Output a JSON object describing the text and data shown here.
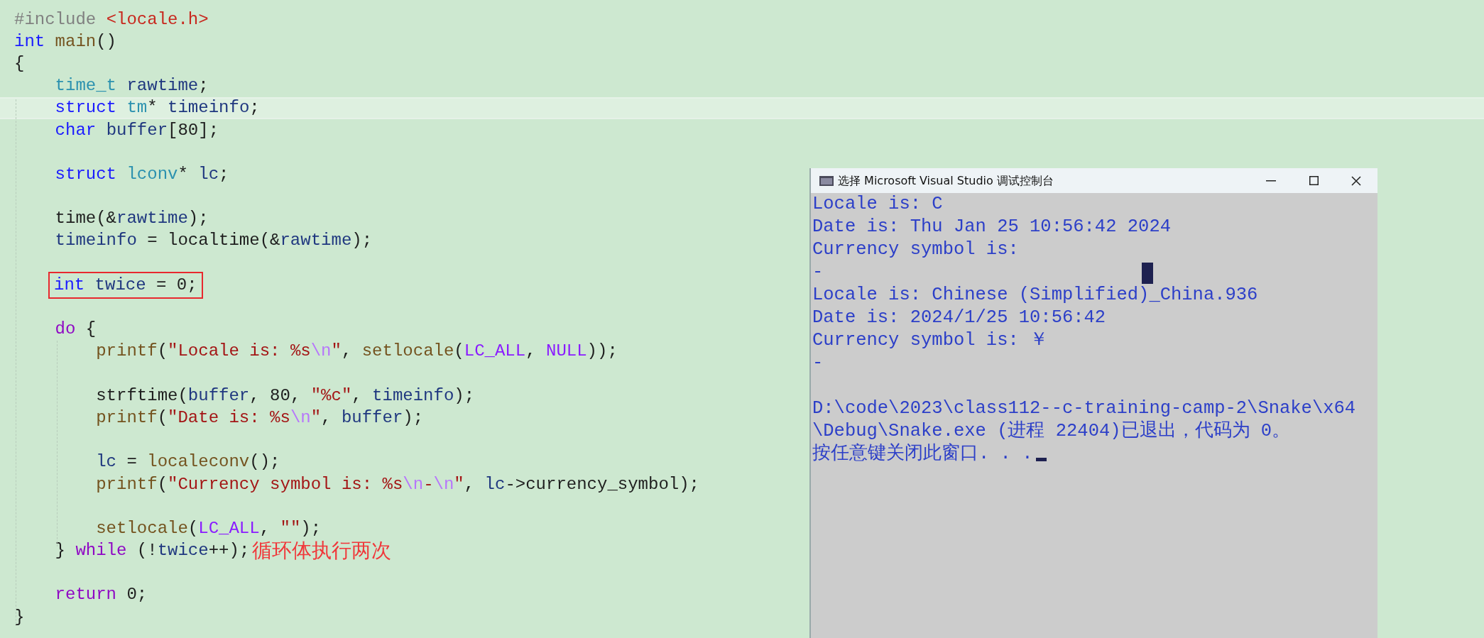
{
  "editor": {
    "lines": [
      {
        "kind": "code",
        "highlighted": false,
        "boxed": false,
        "tokens": [
          {
            "kind": "preproc",
            "text": "#include "
          },
          {
            "kind": "include",
            "text": "<locale.h>"
          }
        ]
      },
      {
        "kind": "code",
        "highlighted": false,
        "boxed": false,
        "tokens": [
          {
            "kind": "keyword",
            "text": "int "
          },
          {
            "kind": "func",
            "text": "main"
          },
          {
            "kind": "plain",
            "text": "()"
          }
        ]
      },
      {
        "kind": "code",
        "highlighted": false,
        "boxed": false,
        "tokens": [
          {
            "kind": "plain",
            "text": "{"
          }
        ]
      },
      {
        "kind": "code",
        "highlighted": false,
        "boxed": false,
        "tokens": [
          {
            "kind": "type",
            "text": "    time_t "
          },
          {
            "kind": "var",
            "text": "rawtime"
          },
          {
            "kind": "plain",
            "text": ";"
          }
        ]
      },
      {
        "kind": "code",
        "highlighted": true,
        "boxed": false,
        "tokens": [
          {
            "kind": "keyword",
            "text": "    struct "
          },
          {
            "kind": "type",
            "text": "tm"
          },
          {
            "kind": "plain",
            "text": "* "
          },
          {
            "kind": "var",
            "text": "timeinfo"
          },
          {
            "kind": "plain",
            "text": ";"
          }
        ]
      },
      {
        "kind": "code",
        "highlighted": false,
        "boxed": false,
        "tokens": [
          {
            "kind": "keyword",
            "text": "    char "
          },
          {
            "kind": "var",
            "text": "buffer"
          },
          {
            "kind": "plain",
            "text": "[80];"
          }
        ]
      },
      {
        "kind": "blank"
      },
      {
        "kind": "code",
        "highlighted": false,
        "boxed": false,
        "tokens": [
          {
            "kind": "keyword",
            "text": "    struct "
          },
          {
            "kind": "type",
            "text": "lconv"
          },
          {
            "kind": "plain",
            "text": "* "
          },
          {
            "kind": "var",
            "text": "lc"
          },
          {
            "kind": "plain",
            "text": ";"
          }
        ]
      },
      {
        "kind": "blank"
      },
      {
        "kind": "code",
        "highlighted": false,
        "boxed": false,
        "tokens": [
          {
            "kind": "plain",
            "text": "    time(&"
          },
          {
            "kind": "var",
            "text": "rawtime"
          },
          {
            "kind": "plain",
            "text": ");"
          }
        ]
      },
      {
        "kind": "code",
        "highlighted": false,
        "boxed": false,
        "tokens": [
          {
            "kind": "var",
            "text": "    timeinfo"
          },
          {
            "kind": "plain",
            "text": " = localtime(&"
          },
          {
            "kind": "var",
            "text": "rawtime"
          },
          {
            "kind": "plain",
            "text": ");"
          }
        ]
      },
      {
        "kind": "blank"
      },
      {
        "kind": "code",
        "highlighted": false,
        "boxed": true,
        "tokens": [
          {
            "kind": "keyword",
            "text": "int "
          },
          {
            "kind": "var",
            "text": "twice"
          },
          {
            "kind": "plain",
            "text": " = 0;"
          }
        ]
      },
      {
        "kind": "blank"
      },
      {
        "kind": "code",
        "highlighted": false,
        "boxed": false,
        "tokens": [
          {
            "kind": "control",
            "text": "    do"
          },
          {
            "kind": "plain",
            "text": " {"
          }
        ]
      },
      {
        "kind": "code",
        "highlighted": false,
        "boxed": false,
        "tokens": [
          {
            "kind": "func",
            "text": "        printf"
          },
          {
            "kind": "plain",
            "text": "("
          },
          {
            "kind": "string",
            "text": "\"Locale is: %s"
          },
          {
            "kind": "escape",
            "text": "\\n"
          },
          {
            "kind": "string",
            "text": "\""
          },
          {
            "kind": "plain",
            "text": ", "
          },
          {
            "kind": "func",
            "text": "setlocale"
          },
          {
            "kind": "plain",
            "text": "("
          },
          {
            "kind": "macro",
            "text": "LC_ALL"
          },
          {
            "kind": "plain",
            "text": ", "
          },
          {
            "kind": "macro",
            "text": "NULL"
          },
          {
            "kind": "plain",
            "text": "));"
          }
        ]
      },
      {
        "kind": "blank"
      },
      {
        "kind": "code",
        "highlighted": false,
        "boxed": false,
        "tokens": [
          {
            "kind": "plain",
            "text": "        strftime("
          },
          {
            "kind": "var",
            "text": "buffer"
          },
          {
            "kind": "plain",
            "text": ", 80, "
          },
          {
            "kind": "string",
            "text": "\"%c\""
          },
          {
            "kind": "plain",
            "text": ", "
          },
          {
            "kind": "var",
            "text": "timeinfo"
          },
          {
            "kind": "plain",
            "text": ");"
          }
        ]
      },
      {
        "kind": "code",
        "highlighted": false,
        "boxed": false,
        "tokens": [
          {
            "kind": "func",
            "text": "        printf"
          },
          {
            "kind": "plain",
            "text": "("
          },
          {
            "kind": "string",
            "text": "\"Date is: %s"
          },
          {
            "kind": "escape",
            "text": "\\n"
          },
          {
            "kind": "string",
            "text": "\""
          },
          {
            "kind": "plain",
            "text": ", "
          },
          {
            "kind": "var",
            "text": "buffer"
          },
          {
            "kind": "plain",
            "text": ");"
          }
        ]
      },
      {
        "kind": "blank"
      },
      {
        "kind": "code",
        "highlighted": false,
        "boxed": false,
        "tokens": [
          {
            "kind": "var",
            "text": "        lc"
          },
          {
            "kind": "plain",
            "text": " = "
          },
          {
            "kind": "func",
            "text": "localeconv"
          },
          {
            "kind": "plain",
            "text": "();"
          }
        ]
      },
      {
        "kind": "code",
        "highlighted": false,
        "boxed": false,
        "tokens": [
          {
            "kind": "func",
            "text": "        printf"
          },
          {
            "kind": "plain",
            "text": "("
          },
          {
            "kind": "string",
            "text": "\"Currency symbol is: %s"
          },
          {
            "kind": "escape",
            "text": "\\n"
          },
          {
            "kind": "string",
            "text": "-"
          },
          {
            "kind": "escape",
            "text": "\\n"
          },
          {
            "kind": "string",
            "text": "\""
          },
          {
            "kind": "plain",
            "text": ", "
          },
          {
            "kind": "var",
            "text": "lc"
          },
          {
            "kind": "plain",
            "text": "->currency_symbol);"
          }
        ]
      },
      {
        "kind": "blank"
      },
      {
        "kind": "code",
        "highlighted": false,
        "boxed": false,
        "tokens": [
          {
            "kind": "func",
            "text": "        setlocale"
          },
          {
            "kind": "plain",
            "text": "("
          },
          {
            "kind": "macro",
            "text": "LC_ALL"
          },
          {
            "kind": "plain",
            "text": ", "
          },
          {
            "kind": "string",
            "text": "\"\""
          },
          {
            "kind": "plain",
            "text": ");"
          }
        ]
      },
      {
        "kind": "code",
        "highlighted": false,
        "boxed": false,
        "annotation": "循环体执行两次",
        "tokens": [
          {
            "kind": "plain",
            "text": "    } "
          },
          {
            "kind": "control",
            "text": "while"
          },
          {
            "kind": "plain",
            "text": " (!"
          },
          {
            "kind": "var",
            "text": "twice"
          },
          {
            "kind": "plain",
            "text": "++);"
          }
        ]
      },
      {
        "kind": "blank"
      },
      {
        "kind": "code",
        "highlighted": false,
        "boxed": false,
        "tokens": [
          {
            "kind": "control",
            "text": "    return"
          },
          {
            "kind": "plain",
            "text": " 0;"
          }
        ]
      },
      {
        "kind": "code",
        "highlighted": false,
        "boxed": false,
        "tokens": [
          {
            "kind": "plain",
            "text": "}"
          }
        ]
      }
    ]
  },
  "console": {
    "title": "选择 Microsoft Visual Studio 调试控制台",
    "lines": [
      {
        "kind": "output",
        "text": "Locale is: C"
      },
      {
        "kind": "output",
        "text": "Date is: Thu Jan 25 10:56:42 2024"
      },
      {
        "kind": "output",
        "text": "Currency symbol is:"
      },
      {
        "kind": "output",
        "text": "-"
      },
      {
        "kind": "output",
        "text": "Locale is: Chinese (Simplified)_China.936"
      },
      {
        "kind": "output",
        "text": "Date is: 2024/1/25 10:56:42"
      },
      {
        "kind": "output",
        "text": "Currency symbol is: ￥"
      },
      {
        "kind": "output",
        "text": "-"
      },
      {
        "kind": "blank"
      },
      {
        "kind": "output",
        "text": "D:\\code\\2023\\class112--c-training-camp-2\\Snake\\x64"
      },
      {
        "kind": "output",
        "text": "\\Debug\\Snake.exe (进程 22404)已退出，代码为 0。"
      },
      {
        "kind": "output",
        "text": "按任意键关闭此窗口. . ."
      }
    ]
  }
}
